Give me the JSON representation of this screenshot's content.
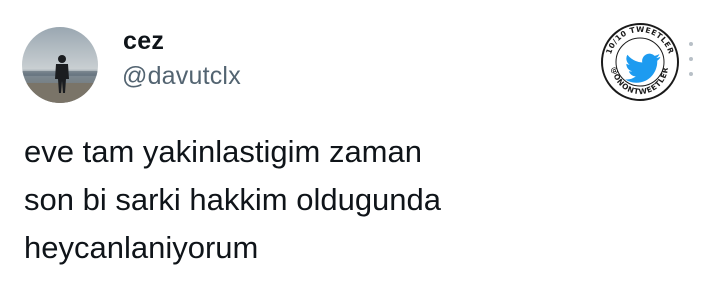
{
  "author": {
    "display_name": "cez",
    "handle": "@davutclx",
    "avatar_icon": "person-on-beach-avatar"
  },
  "tweet": {
    "lines": [
      "eve tam yakinlastigim zaman",
      "son bi sarki hakkim oldugunda",
      "heycanlaniyorum"
    ]
  },
  "badge": {
    "text": "10/10 TWEETLER @ONONTWEETLER",
    "icon": "twitter-bird-icon",
    "bird_color": "#1d9bf0"
  },
  "menu": {
    "icon": "more-vertical-icon"
  }
}
